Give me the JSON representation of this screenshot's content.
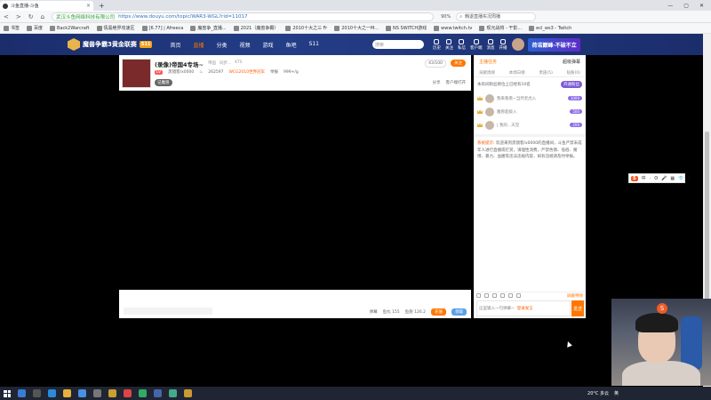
{
  "browser": {
    "tab_title": "斗鱼直播-斗鱼",
    "tab_close": "×",
    "tab_new": "+",
    "win_min": "—",
    "win_max": "▢",
    "win_close": "✕",
    "back": "<",
    "forward": ">",
    "refresh": "↻",
    "home": "⌂",
    "url_secure": "武汉斗鱼网络科技有限公司",
    "url_path": "https://www.douyu.com/topic/WAR3-WGL?rid=11017",
    "zoom": "90%",
    "search_text": "韩退直播实况周播",
    "bookmarks": [
      "书签",
      "百度",
      "Back2Warcraft",
      "情黑绝界攻速区",
      "[6.77] | Afreeca",
      "魔兽争_直播...",
      "2021（魔兽争霸）",
      "2010十大之三 Fr",
      "2010十大之一M...",
      "NS SWITCH游戏",
      "www.twitch.tv",
      "现元战将 - 干影...",
      "ecl_ws3 - Twitch"
    ]
  },
  "site": {
    "logo_text": "魔兽争霸3黄金联赛",
    "logo_badge": "S11",
    "nav": [
      "首页",
      "直播",
      "分类",
      "视频",
      "游戏",
      "鱼吧",
      "S11"
    ],
    "nav_active_index": 1,
    "search_placeholder": "搜索",
    "header_icons": [
      "历史",
      "关注",
      "私信",
      "客户端",
      "消息",
      "开播"
    ],
    "banner_text": "荷诺巅峰·不破不立"
  },
  "room": {
    "title": "(录像)帝国4专场~",
    "category": [
      "帝国",
      "同步...",
      "KTS"
    ],
    "level_badge": "LV",
    "streamer": "黑镜客/x0000",
    "hot": "262597",
    "tag_text": "WCG2010世界冠军",
    "report": "举报",
    "fans": "999+/g",
    "fan_tag": "记魔兽",
    "follow_count": "43/100",
    "follow_btn": "关注",
    "share": "分享",
    "client": "客户端打开",
    "danmu_toggle": "弹幕",
    "energy": "鱼丸 155",
    "fish_ball": "鱼翅 126.2",
    "btn_orange": "充值",
    "btn_blue": "领取"
  },
  "chat": {
    "tab_a": "主播任务",
    "tab_b": "超级弹幕",
    "rank_tabs": [
      "贡献周榜",
      "本场日榜",
      "贵族(5)",
      "钻粉(0)"
    ],
    "rank_note": "本房间粉丝榜位上已经有10名",
    "rank_open": "开通粉丝",
    "rank_rows": [
      {
        "name": "我来看看~当然老虎入",
        "value": "1000"
      },
      {
        "name": "魔兽超级入",
        "value": "500"
      },
      {
        "name": "| 我的...天堂",
        "value": "200"
      }
    ],
    "sys_label": "系统提示:",
    "sys_msg": "欢迎来到黑镜客/x0000的直播间，斗鱼严禁未成年人进行直播或打赏，请理性消费，严禁色情、低俗、赌博、暴力、血腥等违法违规内容，如有违规请及时举报。",
    "tool_right": "屏蔽特效",
    "input_placeholder": "这里输入一句弹幕~",
    "input_red": "登录发言",
    "send": "发送"
  },
  "ime": {
    "logo": "S",
    "items": [
      "中",
      "·",
      "ʘ",
      "🎤",
      "▦",
      "👕",
      "⋮"
    ]
  },
  "taskbar": {
    "weather": "20°C 多云",
    "lang": "英"
  }
}
